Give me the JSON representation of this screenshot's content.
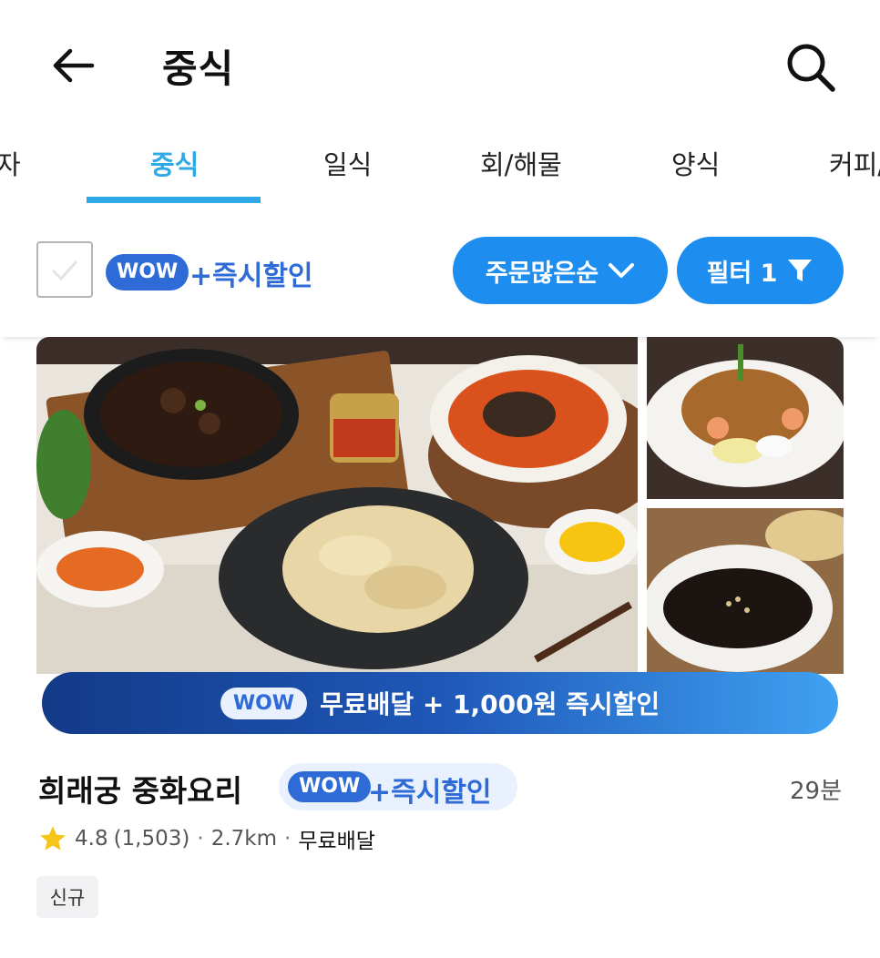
{
  "header": {
    "title": "중식"
  },
  "tabs": [
    "자",
    "중식",
    "일식",
    "회/해물",
    "양식",
    "커피/"
  ],
  "filter_bar": {
    "wow_label": "WOW",
    "discount_label": "+즉시할인",
    "sort_label": "주문많은순",
    "filter_label": "필터 1"
  },
  "promo": {
    "wow_label": "WOW",
    "text": "무료배달 + 1,000원 즉시할인"
  },
  "store": {
    "name": "희래궁 중화요리",
    "wow_label": "WOW",
    "discount_label": "+즉시할인",
    "eta": "29분",
    "rating": "4.8",
    "reviews": "(1,503)",
    "distance": "2.7km",
    "delivery": "무료배달",
    "tag": "신규"
  },
  "colors": {
    "accent": "#2fa9e6",
    "primary_button": "#1e8df0",
    "wow_badge": "#2f6bd6",
    "star": "#f5c518"
  }
}
